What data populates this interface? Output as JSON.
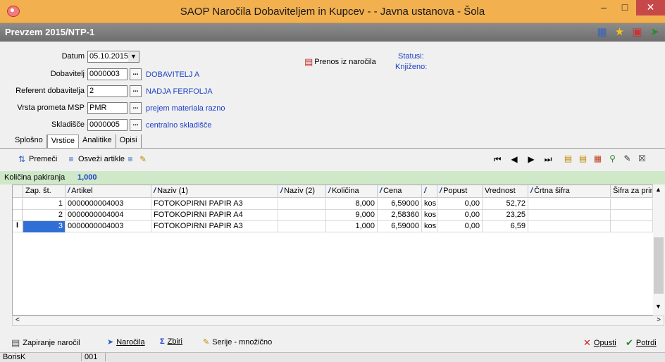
{
  "window": {
    "title": "SAOP   Naročila Dobaviteljem in Kupcev -  - Javna ustanova - Šola"
  },
  "document": {
    "title": "Prevzem 2015/NTP-1"
  },
  "form": {
    "datum_label": "Datum",
    "datum_value": "05.10.2015",
    "dobavitelj_label": "Dobavitelj",
    "dobavitelj_value": "0000003",
    "dobavitelj_desc": "DOBAVITELJ  A",
    "referent_label": "Referent dobavitelja",
    "referent_value": "2",
    "referent_desc": "NADJA FERFOLJA",
    "vrsta_label": "Vrsta prometa MSP",
    "vrsta_value": "PMR",
    "vrsta_desc": "prejem materiala razno",
    "skladisce_label": "Skladišče",
    "skladisce_value": "0000005",
    "skladisce_desc": "centralno skladišče",
    "prenos_label": "Prenos iz naročila",
    "statusi_label": "Statusi:",
    "knjizeno_label": "Knjiženo:"
  },
  "tabs": [
    {
      "label": "Splošno",
      "active": false
    },
    {
      "label": "Vrstice",
      "active": true
    },
    {
      "label": "Analitike",
      "active": false
    },
    {
      "label": "Opisi",
      "active": false
    }
  ],
  "toolbar": {
    "premeci_label": "Premeči",
    "osvezi_label": "Osveži artikle"
  },
  "packaging": {
    "label": "Količina pakiranja",
    "value": "1,000"
  },
  "grid": {
    "headers": {
      "zap": "Zap. št.",
      "artikel": "Artikel",
      "naziv1": "Naziv (1)",
      "naziv2": "Naziv (2)",
      "kolicina": "Količina",
      "cena": "Cena",
      "enota": "",
      "popust": "Popust",
      "vrednost": "Vrednost",
      "crtna": "Črtna šifra",
      "sifra": "Šifra za prime"
    },
    "rows": [
      {
        "zap": "1",
        "artikel": "0000000004003",
        "naziv1": "FOTOKOPIRNI  PAPIR  A3",
        "naziv2": "",
        "kolicina": "8,000",
        "cena": "6,59000",
        "enota": "kos",
        "popust": "0,00",
        "vrednost": "52,72"
      },
      {
        "zap": "2",
        "artikel": "0000000004004",
        "naziv1": "FOTOKOPIRNI  PAPIR  A4",
        "naziv2": "",
        "kolicina": "9,000",
        "cena": "2,58360",
        "enota": "kos",
        "popust": "0,00",
        "vrednost": "23,25"
      },
      {
        "zap": "3",
        "artikel": "0000000004003",
        "naziv1": "FOTOKOPIRNI  PAPIR  A3",
        "naziv2": "",
        "kolicina": "1,000",
        "cena": "6,59000",
        "enota": "kos",
        "popust": "0,00",
        "vrednost": "6,59"
      }
    ]
  },
  "bottom": {
    "zapiranje_label": "Zapiranje naročil",
    "narocila_label": "Naročila",
    "zbiri_label": "Zbiri",
    "serije_label": "Serije - množično",
    "opusti_label": "Opusti",
    "potrdi_label": "Potrdi"
  },
  "status": {
    "user": "BorisK",
    "code": "001"
  }
}
